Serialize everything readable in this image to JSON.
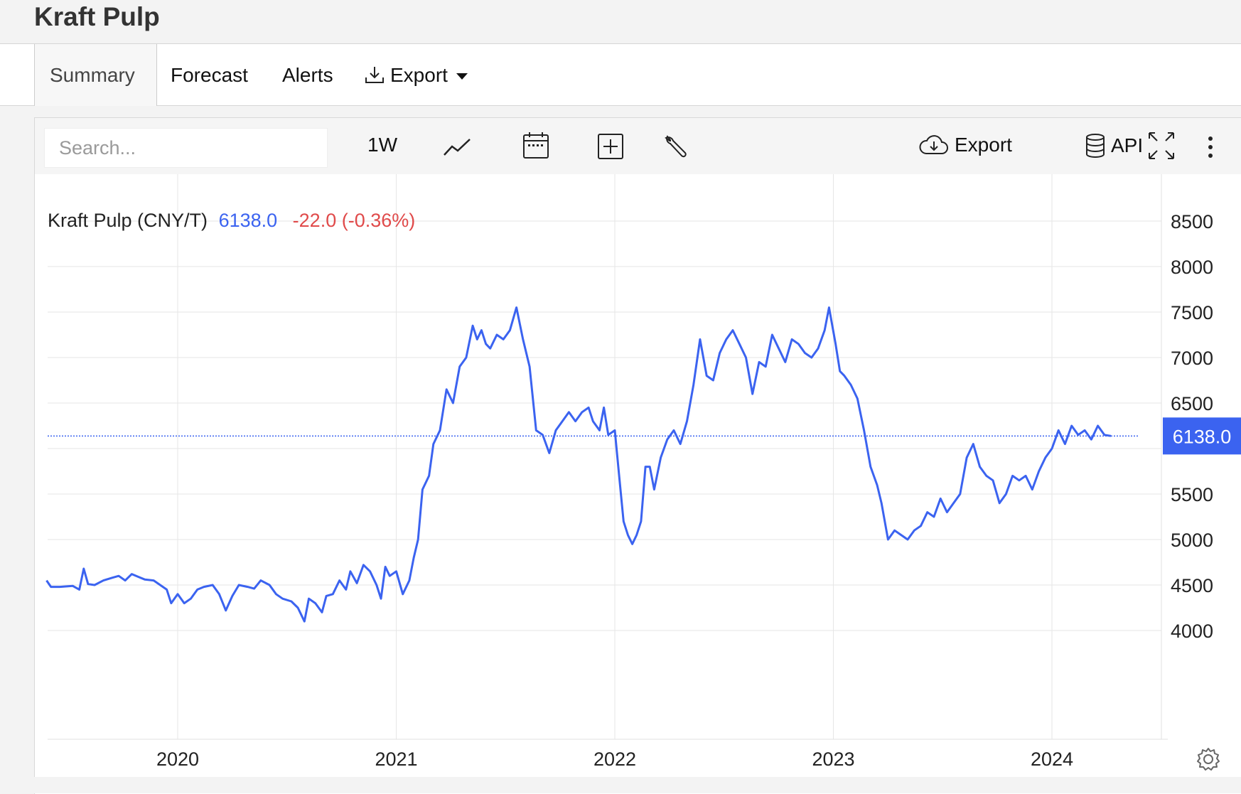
{
  "page": {
    "title": "Kraft Pulp"
  },
  "tabs": [
    {
      "label": "Summary"
    },
    {
      "label": "Forecast"
    },
    {
      "label": "Alerts"
    },
    {
      "label": "Export"
    }
  ],
  "toolbar": {
    "search_placeholder": "Search...",
    "interval": "1W",
    "export_label": "Export",
    "api_label": "API"
  },
  "header": {
    "series_name": "Kraft Pulp (CNY/T)",
    "last_value": "6138.0",
    "change": "-22.0 (-0.36%)"
  },
  "colors": {
    "line": "#3b63f0",
    "negative": "#e04a4a",
    "badge": "#3b63f0"
  },
  "chart_data": {
    "type": "line",
    "title": "Kraft Pulp (CNY/T)",
    "x_axis": {
      "ticks": [
        "2020",
        "2021",
        "2022",
        "2023",
        "2024"
      ],
      "range": [
        2019.4,
        2024.5
      ]
    },
    "y_axis": {
      "ticks": [
        4000,
        4500,
        5000,
        5500,
        6000,
        6500,
        7000,
        7500,
        8000,
        8500
      ],
      "labeled_ticks": [
        4000,
        4500,
        5000,
        5500,
        6500,
        7000,
        7500,
        8000,
        8500
      ],
      "range": [
        3500,
        8700
      ],
      "position": "right"
    },
    "last_value_label": "6138.0",
    "reference_line": 6138,
    "series": [
      {
        "values": [
          [
            2019.4,
            4550
          ],
          [
            2019.42,
            4480
          ],
          [
            2019.46,
            4480
          ],
          [
            2019.52,
            4490
          ],
          [
            2019.55,
            4450
          ],
          [
            2019.57,
            4680
          ],
          [
            2019.59,
            4510
          ],
          [
            2019.62,
            4500
          ],
          [
            2019.66,
            4550
          ],
          [
            2019.7,
            4580
          ],
          [
            2019.73,
            4600
          ],
          [
            2019.76,
            4550
          ],
          [
            2019.79,
            4620
          ],
          [
            2019.82,
            4590
          ],
          [
            2019.85,
            4560
          ],
          [
            2019.89,
            4550
          ],
          [
            2019.92,
            4500
          ],
          [
            2019.95,
            4450
          ],
          [
            2019.97,
            4300
          ],
          [
            2020.0,
            4400
          ],
          [
            2020.03,
            4300
          ],
          [
            2020.06,
            4350
          ],
          [
            2020.09,
            4450
          ],
          [
            2020.12,
            4480
          ],
          [
            2020.16,
            4500
          ],
          [
            2020.19,
            4400
          ],
          [
            2020.22,
            4220
          ],
          [
            2020.25,
            4380
          ],
          [
            2020.28,
            4500
          ],
          [
            2020.32,
            4480
          ],
          [
            2020.35,
            4460
          ],
          [
            2020.38,
            4550
          ],
          [
            2020.42,
            4500
          ],
          [
            2020.45,
            4400
          ],
          [
            2020.48,
            4350
          ],
          [
            2020.52,
            4320
          ],
          [
            2020.55,
            4250
          ],
          [
            2020.58,
            4100
          ],
          [
            2020.6,
            4350
          ],
          [
            2020.63,
            4300
          ],
          [
            2020.66,
            4200
          ],
          [
            2020.68,
            4380
          ],
          [
            2020.71,
            4400
          ],
          [
            2020.74,
            4550
          ],
          [
            2020.77,
            4450
          ],
          [
            2020.79,
            4650
          ],
          [
            2020.82,
            4520
          ],
          [
            2020.85,
            4720
          ],
          [
            2020.88,
            4650
          ],
          [
            2020.91,
            4500
          ],
          [
            2020.93,
            4350
          ],
          [
            2020.95,
            4700
          ],
          [
            2020.97,
            4600
          ],
          [
            2021.0,
            4650
          ],
          [
            2021.03,
            4400
          ],
          [
            2021.06,
            4550
          ],
          [
            2021.08,
            4800
          ],
          [
            2021.1,
            5000
          ],
          [
            2021.12,
            5550
          ],
          [
            2021.15,
            5700
          ],
          [
            2021.17,
            6050
          ],
          [
            2021.2,
            6200
          ],
          [
            2021.23,
            6650
          ],
          [
            2021.26,
            6500
          ],
          [
            2021.29,
            6900
          ],
          [
            2021.32,
            7000
          ],
          [
            2021.35,
            7350
          ],
          [
            2021.37,
            7200
          ],
          [
            2021.39,
            7300
          ],
          [
            2021.41,
            7150
          ],
          [
            2021.43,
            7100
          ],
          [
            2021.46,
            7250
          ],
          [
            2021.49,
            7200
          ],
          [
            2021.52,
            7300
          ],
          [
            2021.55,
            7550
          ],
          [
            2021.58,
            7200
          ],
          [
            2021.61,
            6900
          ],
          [
            2021.64,
            6200
          ],
          [
            2021.67,
            6150
          ],
          [
            2021.7,
            5950
          ],
          [
            2021.73,
            6200
          ],
          [
            2021.76,
            6300
          ],
          [
            2021.79,
            6400
          ],
          [
            2021.82,
            6300
          ],
          [
            2021.85,
            6400
          ],
          [
            2021.88,
            6450
          ],
          [
            2021.9,
            6300
          ],
          [
            2021.93,
            6200
          ],
          [
            2021.95,
            6450
          ],
          [
            2021.97,
            6150
          ],
          [
            2022.0,
            6200
          ],
          [
            2022.02,
            5700
          ],
          [
            2022.04,
            5200
          ],
          [
            2022.06,
            5050
          ],
          [
            2022.08,
            4950
          ],
          [
            2022.1,
            5050
          ],
          [
            2022.12,
            5200
          ],
          [
            2022.14,
            5800
          ],
          [
            2022.16,
            5800
          ],
          [
            2022.18,
            5550
          ],
          [
            2022.21,
            5900
          ],
          [
            2022.24,
            6100
          ],
          [
            2022.27,
            6200
          ],
          [
            2022.3,
            6050
          ],
          [
            2022.33,
            6300
          ],
          [
            2022.36,
            6700
          ],
          [
            2022.39,
            7200
          ],
          [
            2022.42,
            6800
          ],
          [
            2022.45,
            6750
          ],
          [
            2022.48,
            7050
          ],
          [
            2022.51,
            7200
          ],
          [
            2022.54,
            7300
          ],
          [
            2022.57,
            7150
          ],
          [
            2022.6,
            7000
          ],
          [
            2022.63,
            6600
          ],
          [
            2022.66,
            6950
          ],
          [
            2022.69,
            6900
          ],
          [
            2022.72,
            7250
          ],
          [
            2022.75,
            7100
          ],
          [
            2022.78,
            6950
          ],
          [
            2022.81,
            7200
          ],
          [
            2022.84,
            7150
          ],
          [
            2022.87,
            7050
          ],
          [
            2022.9,
            7000
          ],
          [
            2022.93,
            7100
          ],
          [
            2022.96,
            7300
          ],
          [
            2022.98,
            7550
          ],
          [
            2023.01,
            7150
          ],
          [
            2023.03,
            6850
          ],
          [
            2023.05,
            6800
          ],
          [
            2023.08,
            6700
          ],
          [
            2023.11,
            6550
          ],
          [
            2023.14,
            6200
          ],
          [
            2023.17,
            5800
          ],
          [
            2023.2,
            5600
          ],
          [
            2023.22,
            5400
          ],
          [
            2023.25,
            5000
          ],
          [
            2023.28,
            5100
          ],
          [
            2023.31,
            5050
          ],
          [
            2023.34,
            5000
          ],
          [
            2023.37,
            5100
          ],
          [
            2023.4,
            5150
          ],
          [
            2023.43,
            5300
          ],
          [
            2023.46,
            5250
          ],
          [
            2023.49,
            5450
          ],
          [
            2023.52,
            5300
          ],
          [
            2023.55,
            5400
          ],
          [
            2023.58,
            5500
          ],
          [
            2023.61,
            5900
          ],
          [
            2023.64,
            6050
          ],
          [
            2023.67,
            5800
          ],
          [
            2023.7,
            5700
          ],
          [
            2023.73,
            5650
          ],
          [
            2023.76,
            5400
          ],
          [
            2023.79,
            5500
          ],
          [
            2023.82,
            5700
          ],
          [
            2023.85,
            5650
          ],
          [
            2023.88,
            5700
          ],
          [
            2023.91,
            5550
          ],
          [
            2023.94,
            5750
          ],
          [
            2023.97,
            5900
          ],
          [
            2024.0,
            6000
          ],
          [
            2024.03,
            6200
          ],
          [
            2024.06,
            6050
          ],
          [
            2024.09,
            6250
          ],
          [
            2024.12,
            6150
          ],
          [
            2024.15,
            6200
          ],
          [
            2024.18,
            6100
          ],
          [
            2024.21,
            6250
          ],
          [
            2024.24,
            6150
          ],
          [
            2024.27,
            6138
          ]
        ]
      }
    ]
  }
}
